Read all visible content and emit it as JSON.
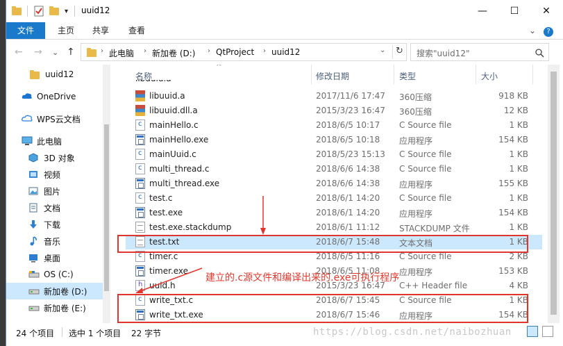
{
  "window": {
    "title": "uuid12",
    "minimize": "—",
    "maximize": "☐",
    "close": "✕"
  },
  "ribbon": {
    "tabs": [
      "文件",
      "主页",
      "共享",
      "查看"
    ],
    "expand": "⌄",
    "help": "?"
  },
  "address": {
    "back": "←",
    "forward": "→",
    "recent": "⌄",
    "up": "↑",
    "crumbs": [
      "此电脑",
      "新加卷 (D:)",
      "QtProject",
      "uuid12"
    ],
    "search_placeholder": "搜索\"uuid12\""
  },
  "nav": {
    "items": [
      {
        "label": "uuid12",
        "icon": "folder-icon"
      },
      {
        "label": "OneDrive",
        "icon": "cloud-icon"
      },
      {
        "label": "WPS云文档",
        "icon": "cloud-icon"
      },
      {
        "label": "此电脑",
        "icon": "computer-icon"
      },
      {
        "label": "3D 对象",
        "icon": "cube-icon"
      },
      {
        "label": "视频",
        "icon": "video-icon"
      },
      {
        "label": "图片",
        "icon": "picture-icon"
      },
      {
        "label": "文档",
        "icon": "document-icon"
      },
      {
        "label": "下载",
        "icon": "download-icon"
      },
      {
        "label": "音乐",
        "icon": "music-icon"
      },
      {
        "label": "桌面",
        "icon": "desktop-icon"
      },
      {
        "label": "OS (C:)",
        "icon": "drive-icon"
      },
      {
        "label": "新加卷 (D:)",
        "icon": "drive-icon"
      },
      {
        "label": "新加卷 (E:)",
        "icon": "drive-icon"
      }
    ]
  },
  "columns": [
    "名称",
    "修改日期",
    "类型",
    "大小"
  ],
  "files": [
    {
      "name": "libuuid.a",
      "date": "2017/11/6 17:47",
      "type": "360压缩",
      "size": "918 KB",
      "icon": "archive"
    },
    {
      "name": "libuuid.dll.a",
      "date": "2015/3/23 16:47",
      "type": "360压缩",
      "size": "12 KB",
      "icon": "archive"
    },
    {
      "name": "mainHello.c",
      "date": "2018/6/5 10:17",
      "type": "C Source file",
      "size": "1 KB",
      "icon": "c"
    },
    {
      "name": "mainHello.exe",
      "date": "2018/6/5 10:18",
      "type": "应用程序",
      "size": "154 KB",
      "icon": "exe"
    },
    {
      "name": "mainUuid.c",
      "date": "2018/5/23 15:13",
      "type": "C Source file",
      "size": "1 KB",
      "icon": "c"
    },
    {
      "name": "multi_thread.c",
      "date": "2018/6/6 14:38",
      "type": "C Source file",
      "size": "1 KB",
      "icon": "c"
    },
    {
      "name": "multi_thread.exe",
      "date": "2018/6/6 14:38",
      "type": "应用程序",
      "size": "155 KB",
      "icon": "exe"
    },
    {
      "name": "test.c",
      "date": "2018/6/1 14:20",
      "type": "C Source file",
      "size": "1 KB",
      "icon": "c"
    },
    {
      "name": "test.exe",
      "date": "2018/6/1 14:20",
      "type": "应用程序",
      "size": "154 KB",
      "icon": "exe"
    },
    {
      "name": "test.exe.stackdump",
      "date": "2018/6/1 11:12",
      "type": "STACKDUMP 文件",
      "size": "1 KB",
      "icon": "doc"
    },
    {
      "name": "test.txt",
      "date": "2018/6/7 15:48",
      "type": "文本文档",
      "size": "1 KB",
      "icon": "doc"
    },
    {
      "name": "timer.c",
      "date": "2018/6/5 11:16",
      "type": "C Source file",
      "size": "2 KB",
      "icon": "c"
    },
    {
      "name": "timer.exe",
      "date": "2018/6/5 11:08",
      "type": "应用程序",
      "size": "153 KB",
      "icon": "exe"
    },
    {
      "name": "uuid.h",
      "date": "2015/3/23 16:47",
      "type": "C++ Header file",
      "size": "4 KB",
      "icon": "h"
    },
    {
      "name": "write_txt.c",
      "date": "2018/6/7 15:45",
      "type": "C Source file",
      "size": "1 KB",
      "icon": "c"
    },
    {
      "name": "write_txt.exe",
      "date": "2018/6/7 15:46",
      "type": "应用程序",
      "size": "154 KB",
      "icon": "exe"
    }
  ],
  "status": {
    "count": "24 个项目",
    "selected": "选中 1 个项目",
    "bytes": "22 字节"
  },
  "annotation": {
    "text": "建立的.c源文件和编译出来的.exe可执行程序",
    "color": "#e0342e"
  },
  "watermark": "https://blog.csdn.net/naibozhuan"
}
